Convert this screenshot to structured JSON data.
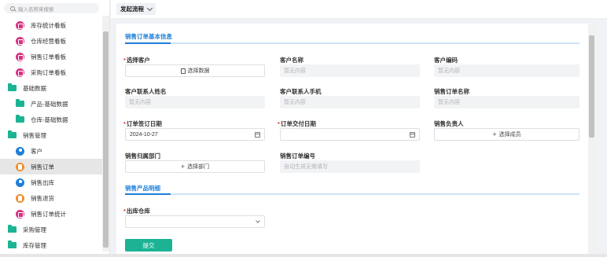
{
  "sidebar": {
    "search_placeholder": "输入名称来搜索",
    "items": [
      {
        "label": "库存统计看板",
        "level": 2,
        "icon": "board-icon"
      },
      {
        "label": "仓库经营看板",
        "level": 2,
        "icon": "board-icon"
      },
      {
        "label": "销售订单看板",
        "level": 2,
        "icon": "board-icon"
      },
      {
        "label": "采购订单看板",
        "level": 2,
        "icon": "board-icon"
      },
      {
        "label": "基础数据",
        "level": 1,
        "icon": "folder-icon"
      },
      {
        "label": "产品-基础数据",
        "level": 2,
        "icon": "folder-icon"
      },
      {
        "label": "仓库-基础数据",
        "level": 2,
        "icon": "folder-icon"
      },
      {
        "label": "销售管理",
        "level": 1,
        "icon": "folder-icon"
      },
      {
        "label": "客户",
        "level": 2,
        "icon": "user-icon"
      },
      {
        "label": "销售订单",
        "level": 2,
        "icon": "order-icon",
        "active": true
      },
      {
        "label": "销售出库",
        "level": 2,
        "icon": "doc-icon"
      },
      {
        "label": "销售退货",
        "level": 2,
        "icon": "order-icon"
      },
      {
        "label": "销售订单统计",
        "level": 2,
        "icon": "board-icon"
      },
      {
        "label": "采购管理",
        "level": 1,
        "icon": "folder-icon"
      },
      {
        "label": "库存管理",
        "level": 1,
        "icon": "folder-icon"
      }
    ]
  },
  "topbar": {
    "flow_tab": "发起流程"
  },
  "form": {
    "section1_title": "销售订单基本信息",
    "section2_title": "销售产品明细",
    "select_customer_label": "选择客户",
    "select_customer_btn": "选择数据",
    "customer_name_label": "客户名称",
    "customer_name_value": "暂无内容",
    "customer_code_label": "客户编码",
    "customer_code_value": "暂无内容",
    "contact_name_label": "客户联系人姓名",
    "contact_name_value": "暂无内容",
    "contact_phone_label": "客户联系人手机",
    "contact_phone_value": "暂无内容",
    "order_name_label": "销售订单名称",
    "order_name_value": "暂无内容",
    "sign_date_label": "订单签订日期",
    "sign_date_value": "2024-10-27",
    "delivery_date_label": "订单交付日期",
    "delivery_date_value": "",
    "sales_person_label": "销售负责人",
    "sales_person_btn": "选择成员",
    "dept_label": "销售归属部门",
    "dept_btn": "选择部门",
    "order_no_label": "销售订单编号",
    "order_no_value": "自动生成无需填写",
    "warehouse_label": "出库仓库",
    "warehouse_value": "",
    "submit_label": "提交"
  },
  "colors": {
    "accent": "#1e7fd9",
    "submit": "#1bb394",
    "required": "#e53935"
  }
}
